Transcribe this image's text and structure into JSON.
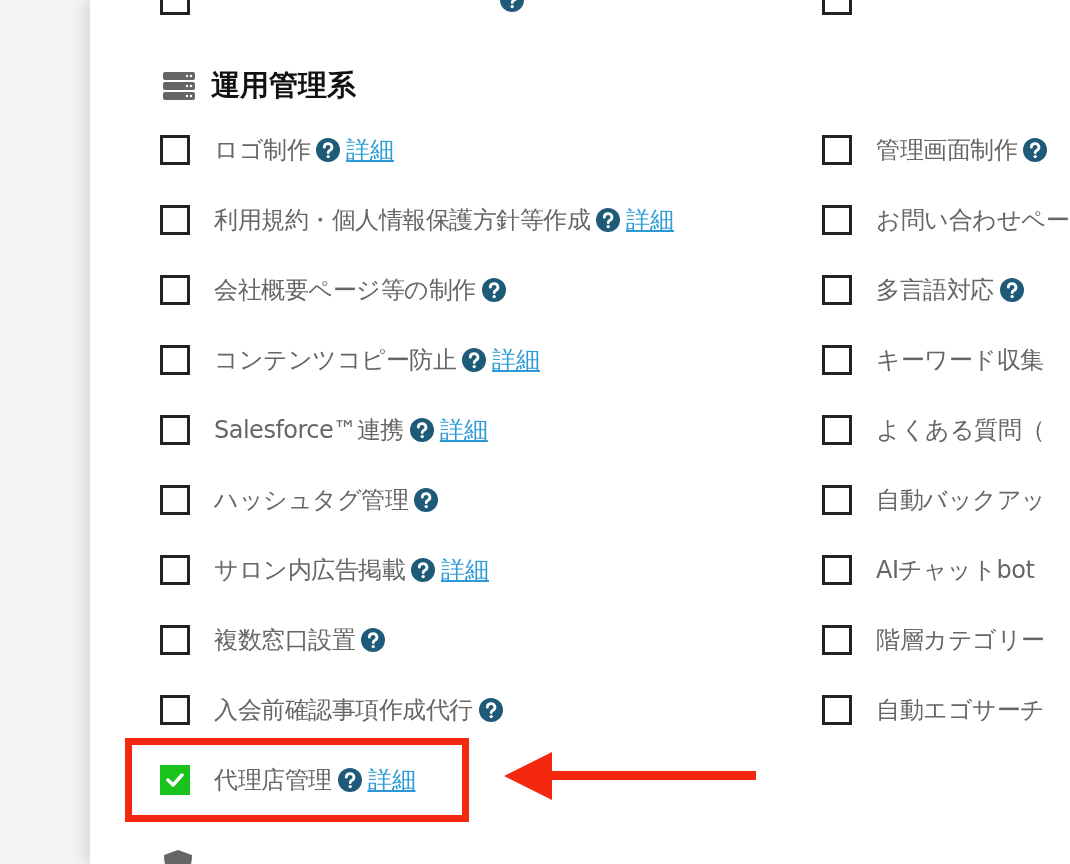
{
  "sections": [
    {
      "rows": [
        {
          "left": {
            "checked": false,
            "help": true,
            "highlighted": false
          },
          "right": {
            "checked": false,
            "help": false,
            "highlighted": false
          }
        }
      ]
    },
    {
      "title": "運用管理系",
      "kind": "server",
      "rows": [
        {
          "left": {
            "label": "ロゴ制作",
            "checked": false,
            "help": true,
            "link": "詳細",
            "highlighted": false
          },
          "right": {
            "label": "管理画面制作",
            "checked": false,
            "help": true,
            "highlighted": false
          }
        },
        {
          "left": {
            "label": "利用規約・個人情報保護方針等作成",
            "checked": false,
            "help": true,
            "link": "詳細",
            "highlighted": false
          },
          "right": {
            "label": "お問い合わせペー",
            "checked": false,
            "help": false,
            "highlighted": false
          }
        },
        {
          "left": {
            "label": "会社概要ページ等の制作",
            "checked": false,
            "help": true,
            "highlighted": false
          },
          "right": {
            "label": "多言語対応",
            "checked": false,
            "help": true,
            "highlighted": false
          }
        },
        {
          "left": {
            "label": "コンテンツコピー防止",
            "checked": false,
            "help": true,
            "link": "詳細",
            "highlighted": false
          },
          "right": {
            "label": "キーワード収集",
            "checked": false,
            "help": false,
            "highlighted": false
          }
        },
        {
          "left": {
            "label": "Salesforce™連携",
            "checked": false,
            "help": true,
            "link": "詳細",
            "highlighted": false
          },
          "right": {
            "label": "よくある質問（",
            "checked": false,
            "help": false,
            "highlighted": false
          }
        },
        {
          "left": {
            "label": "ハッシュタグ管理",
            "checked": false,
            "help": true,
            "highlighted": false
          },
          "right": {
            "label": "自動バックアッ",
            "checked": false,
            "help": false,
            "highlighted": false
          }
        },
        {
          "left": {
            "label": "サロン内広告掲載",
            "checked": false,
            "help": true,
            "link": "詳細",
            "highlighted": false
          },
          "right": {
            "label": "AIチャットbot",
            "checked": false,
            "help": false,
            "highlighted": false
          }
        },
        {
          "left": {
            "label": "複数窓口設置",
            "checked": false,
            "help": true,
            "highlighted": false
          },
          "right": {
            "label": "階層カテゴリー",
            "checked": false,
            "help": false,
            "highlighted": false
          }
        },
        {
          "left": {
            "label": "入会前確認事項作成代行",
            "checked": false,
            "help": true,
            "highlighted": false
          },
          "right": {
            "label": "自動エゴサーチ",
            "checked": false,
            "help": false,
            "highlighted": false
          }
        },
        {
          "left": {
            "label": "代理店管理",
            "checked": true,
            "help": true,
            "link": "詳細",
            "highlighted": true
          }
        }
      ]
    },
    {
      "kind": "shield"
    }
  ]
}
